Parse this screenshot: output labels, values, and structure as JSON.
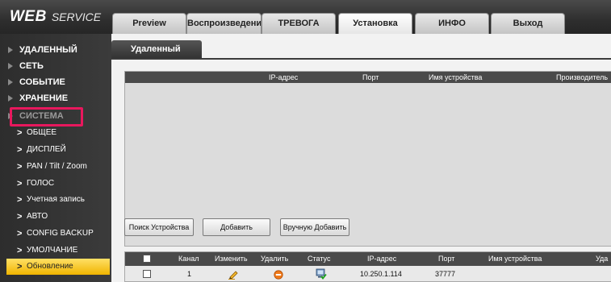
{
  "logo": {
    "main": "WEB",
    "sub": "SERVICE"
  },
  "tabs": [
    {
      "label": "Preview"
    },
    {
      "label": "Воспроизведение"
    },
    {
      "label": "ТРЕВОГА"
    },
    {
      "label": "Установка"
    },
    {
      "label": "ИНФО"
    },
    {
      "label": "Выход"
    }
  ],
  "active_tab": "Установка",
  "sidebar": {
    "sections": [
      "УДАЛЕННЫЙ",
      "СЕТЬ",
      "СОБЫТИЕ",
      "ХРАНЕНИЕ",
      "СИСТЕМА"
    ],
    "items": [
      "ОБЩЕЕ",
      "ДИСПЛЕЙ",
      "PAN / Tilt / Zoom",
      "ГОЛОС",
      "Учетная запись",
      "АВТО",
      "CONFIG BACKUP",
      "УМОЛЧАНИЕ",
      "Обновление"
    ],
    "selected": "Обновление",
    "highlight_color": "#e8185d"
  },
  "page": {
    "tab_label": "Удаленный",
    "search_columns": [
      "IP-адрес",
      "Порт",
      "Имя устройства",
      "Производитель"
    ],
    "buttons": {
      "search": "Поиск Устройства",
      "add": "Добавить",
      "manual_add": "Вручную Добавить"
    },
    "added_columns": [
      "Канал",
      "Изменить",
      "Удалить",
      "Статус",
      "IP-адрес",
      "Порт",
      "Имя устройства",
      "Уда"
    ],
    "rows": [
      {
        "channel": "1",
        "ip": "10.250.1.114",
        "port": "37777",
        "name": "",
        "edit_icon": "pencil-icon",
        "delete_icon": "delete-icon",
        "status_icon": "status-ok-icon"
      }
    ]
  }
}
